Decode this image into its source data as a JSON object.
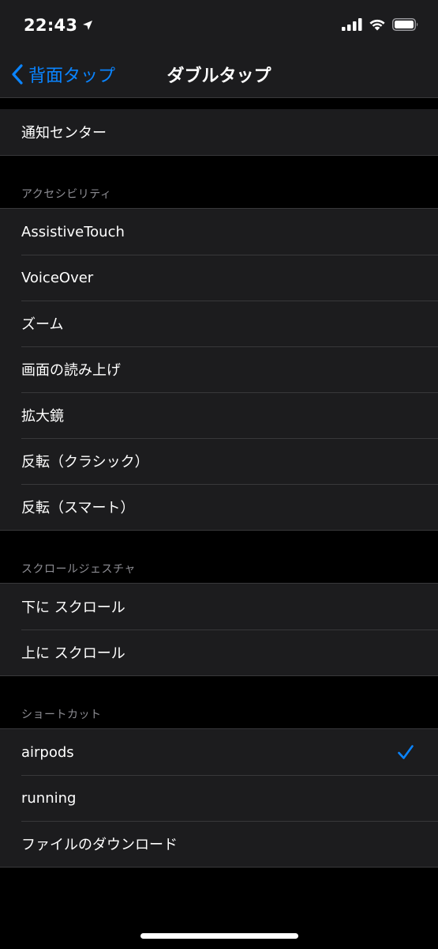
{
  "status_bar": {
    "time": "22:43",
    "location_icon": "location-arrow-icon",
    "signal_icon": "cellular-signal-icon",
    "wifi_icon": "wifi-icon",
    "battery_icon": "battery-icon"
  },
  "nav": {
    "back_label": "背面タップ",
    "title": "ダブルタップ",
    "accent_color": "#0a84ff"
  },
  "top_group": {
    "items": [
      {
        "label": "通知センター"
      }
    ]
  },
  "accessibility": {
    "header": "アクセシビリティ",
    "items": [
      {
        "label": "AssistiveTouch"
      },
      {
        "label": "VoiceOver"
      },
      {
        "label": "ズーム"
      },
      {
        "label": "画面の読み上げ"
      },
      {
        "label": "拡大鏡"
      },
      {
        "label": "反転（クラシック）"
      },
      {
        "label": "反転（スマート）"
      }
    ]
  },
  "scroll_gesture": {
    "header": "スクロールジェスチャ",
    "items": [
      {
        "label": "下に スクロール"
      },
      {
        "label": "上に スクロール"
      }
    ]
  },
  "shortcuts": {
    "header": "ショートカット",
    "items": [
      {
        "label": "airpods",
        "selected": true
      },
      {
        "label": "running",
        "selected": false
      },
      {
        "label": "ファイルのダウンロード",
        "selected": false
      }
    ]
  }
}
